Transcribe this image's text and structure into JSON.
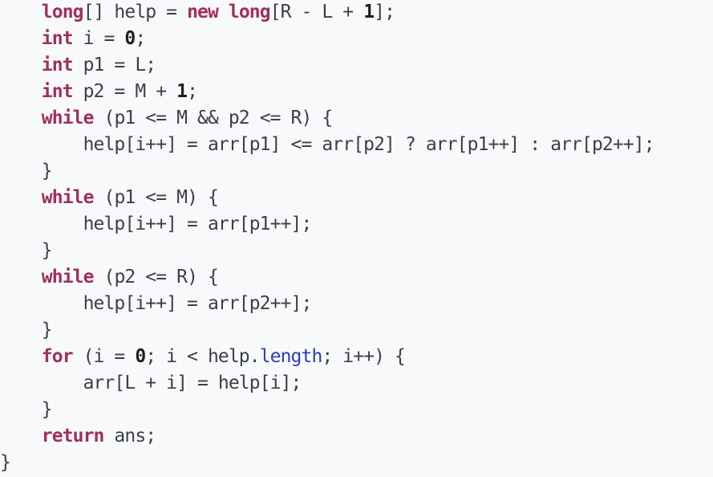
{
  "code": {
    "lines": [
      [
        {
          "t": "    ",
          "c": "plain"
        },
        {
          "t": "long",
          "c": "kw"
        },
        {
          "t": "[] help = ",
          "c": "plain"
        },
        {
          "t": "new",
          "c": "kw"
        },
        {
          "t": " ",
          "c": "plain"
        },
        {
          "t": "long",
          "c": "kw"
        },
        {
          "t": "[R - L + ",
          "c": "plain"
        },
        {
          "t": "1",
          "c": "num"
        },
        {
          "t": "];",
          "c": "plain"
        }
      ],
      [
        {
          "t": "    ",
          "c": "plain"
        },
        {
          "t": "int",
          "c": "kw"
        },
        {
          "t": " i = ",
          "c": "plain"
        },
        {
          "t": "0",
          "c": "num"
        },
        {
          "t": ";",
          "c": "plain"
        }
      ],
      [
        {
          "t": "    ",
          "c": "plain"
        },
        {
          "t": "int",
          "c": "kw"
        },
        {
          "t": " p1 = L;",
          "c": "plain"
        }
      ],
      [
        {
          "t": "    ",
          "c": "plain"
        },
        {
          "t": "int",
          "c": "kw"
        },
        {
          "t": " p2 = M + ",
          "c": "plain"
        },
        {
          "t": "1",
          "c": "num"
        },
        {
          "t": ";",
          "c": "plain"
        }
      ],
      [
        {
          "t": "    ",
          "c": "plain"
        },
        {
          "t": "while",
          "c": "kw"
        },
        {
          "t": " (p1 <= M && p2 <= R) {",
          "c": "plain"
        }
      ],
      [
        {
          "t": "        help[i++] = arr[p1] <= arr[p2] ? arr[p1++] : arr[p2++];",
          "c": "plain"
        }
      ],
      [
        {
          "t": "    }",
          "c": "plain"
        }
      ],
      [
        {
          "t": "    ",
          "c": "plain"
        },
        {
          "t": "while",
          "c": "kw"
        },
        {
          "t": " (p1 <= M) {",
          "c": "plain"
        }
      ],
      [
        {
          "t": "        help[i++] = arr[p1++];",
          "c": "plain"
        }
      ],
      [
        {
          "t": "    }",
          "c": "plain"
        }
      ],
      [
        {
          "t": "    ",
          "c": "plain"
        },
        {
          "t": "while",
          "c": "kw"
        },
        {
          "t": " (p2 <= R) {",
          "c": "plain"
        }
      ],
      [
        {
          "t": "        help[i++] = arr[p2++];",
          "c": "plain"
        }
      ],
      [
        {
          "t": "    }",
          "c": "plain"
        }
      ],
      [
        {
          "t": "    ",
          "c": "plain"
        },
        {
          "t": "for",
          "c": "kw"
        },
        {
          "t": " (i = ",
          "c": "plain"
        },
        {
          "t": "0",
          "c": "num"
        },
        {
          "t": "; i < help.",
          "c": "plain"
        },
        {
          "t": "length",
          "c": "field"
        },
        {
          "t": "; i++) {",
          "c": "plain"
        }
      ],
      [
        {
          "t": "        arr[L + i] = help[i];",
          "c": "plain"
        }
      ],
      [
        {
          "t": "    }",
          "c": "plain"
        }
      ],
      [
        {
          "t": "    ",
          "c": "plain"
        },
        {
          "t": "return",
          "c": "kw"
        },
        {
          "t": " ans;",
          "c": "plain"
        }
      ],
      [
        {
          "t": "}",
          "c": "plain"
        }
      ]
    ]
  },
  "colors": {
    "background": "#f8f9fb",
    "keyword": "#a0305a",
    "number": "#1f1f1f",
    "field": "#2b3db8",
    "text": "#3b3f48"
  }
}
